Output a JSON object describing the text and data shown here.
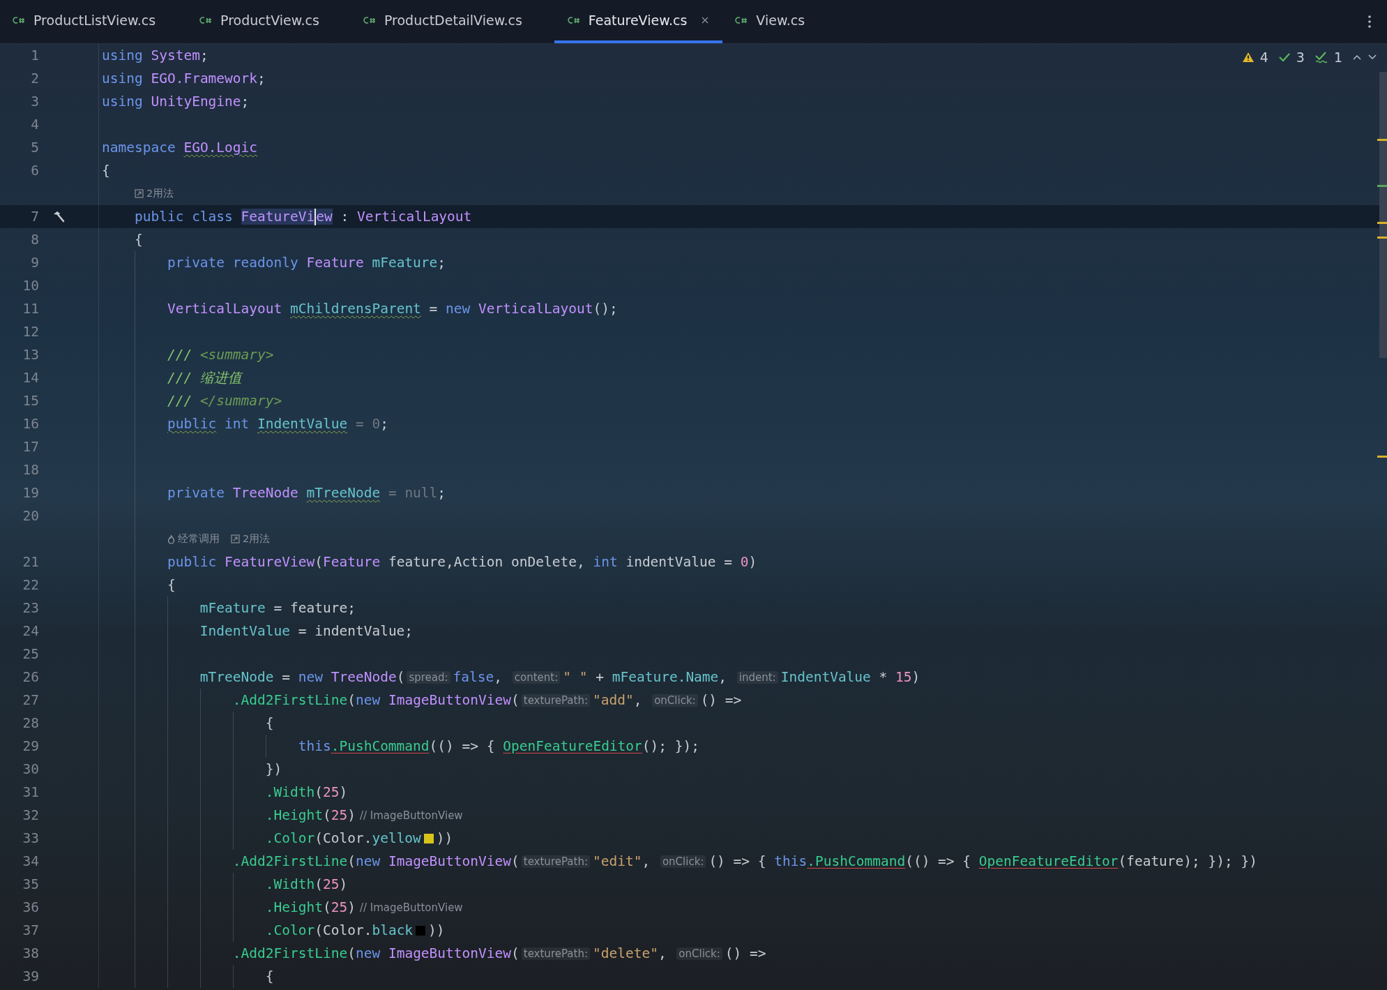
{
  "tabs": [
    {
      "label": "ProductListView.cs",
      "selected": false
    },
    {
      "label": "ProductView.cs",
      "selected": false
    },
    {
      "label": "ProductDetailView.cs",
      "selected": false
    },
    {
      "label": "FeatureView.cs",
      "selected": true
    },
    {
      "label": "View.cs",
      "selected": false
    }
  ],
  "inspections": {
    "warnings": "4",
    "weak_warnings": "3",
    "typos": "1"
  },
  "lines": [
    {
      "kind": "code",
      "number": "1",
      "tokens": [
        {
          "kind": "kw",
          "text": "using"
        },
        {
          "kind": "ns",
          "text": "System",
          "gap": true
        },
        {
          "kind": "plain",
          "text": ";"
        }
      ]
    },
    {
      "kind": "code",
      "number": "2",
      "tokens": [
        {
          "kind": "kw",
          "text": "using"
        },
        {
          "kind": "ns",
          "text": "EGO.Framework",
          "gap": true
        },
        {
          "kind": "plain",
          "text": ";"
        }
      ]
    },
    {
      "kind": "code",
      "number": "3",
      "tokens": [
        {
          "kind": "kw",
          "text": "using"
        },
        {
          "kind": "ns",
          "text": "UnityEngine",
          "gap": true
        },
        {
          "kind": "plain",
          "text": ";"
        }
      ]
    },
    {
      "kind": "code",
      "number": "4"
    },
    {
      "kind": "code",
      "number": "5",
      "tokens": [
        {
          "kind": "kw",
          "text": "namespace"
        },
        {
          "kind": "ns",
          "text": "EGO.Logic",
          "gap": true,
          "warning": true
        }
      ]
    },
    {
      "kind": "code",
      "number": "6",
      "tokens": [
        {
          "kind": "plain",
          "text": "{"
        }
      ],
      "children": [
        {
          "kind": "lens",
          "entries": [
            {
              "kind": "usages",
              "text": "2用法"
            }
          ]
        },
        {
          "kind": "code",
          "number": "7",
          "current": true,
          "build_marker": true,
          "tokens": [
            {
              "kind": "kw",
              "text": "public class"
            },
            {
              "kind": "type",
              "text": "FeatureVi",
              "gap": true,
              "highlight": true
            },
            {
              "kind": "caret"
            },
            {
              "kind": "type",
              "text": "ew",
              "highlight": true
            },
            {
              "kind": "plain",
              "text": " : "
            },
            {
              "kind": "type",
              "text": "VerticalLayout"
            }
          ]
        },
        {
          "kind": "code",
          "number": "8",
          "tokens": [
            {
              "kind": "plain",
              "text": "{"
            }
          ],
          "children": [
            {
              "kind": "code",
              "number": "9",
              "tokens": [
                {
                  "kind": "kw",
                  "text": "private readonly"
                },
                {
                  "kind": "type",
                  "text": "Feature",
                  "gap": true
                },
                {
                  "kind": "field",
                  "text": "mFeature",
                  "gap": true
                },
                {
                  "kind": "plain",
                  "text": ";"
                }
              ]
            },
            {
              "kind": "code",
              "number": "10"
            },
            {
              "kind": "code",
              "number": "11",
              "tokens": [
                {
                  "kind": "type",
                  "text": "VerticalLayout"
                },
                {
                  "kind": "field",
                  "text": "mChildrensParent",
                  "gap": true,
                  "warning": true
                },
                {
                  "kind": "plain",
                  "text": " = "
                },
                {
                  "kind": "kw",
                  "text": "new"
                },
                {
                  "kind": "type",
                  "text": "VerticalLayout",
                  "gap": true
                },
                {
                  "kind": "plain",
                  "text": "();"
                }
              ]
            },
            {
              "kind": "code",
              "number": "12"
            },
            {
              "kind": "code",
              "number": "13",
              "tokens": [
                {
                  "kind": "comment",
                  "text": "///"
                },
                {
                  "kind": "doctag",
                  "text": "<summary>",
                  "gap": true
                }
              ]
            },
            {
              "kind": "code",
              "number": "14",
              "tokens": [
                {
                  "kind": "comment",
                  "text": "/// 缩进值"
                }
              ]
            },
            {
              "kind": "code",
              "number": "15",
              "tokens": [
                {
                  "kind": "comment",
                  "text": "///"
                },
                {
                  "kind": "doctag",
                  "text": "</summary>",
                  "gap": true
                }
              ]
            },
            {
              "kind": "code",
              "number": "16",
              "tokens": [
                {
                  "kind": "kw",
                  "text": "public",
                  "warning": true
                },
                {
                  "kind": "kw",
                  "text": "int",
                  "gap": true
                },
                {
                  "kind": "field",
                  "text": "IndentValue",
                  "gap": true,
                  "warning": true
                },
                {
                  "kind": "dim",
                  "text": " = 0"
                },
                {
                  "kind": "plain",
                  "text": ";"
                }
              ]
            },
            {
              "kind": "code",
              "number": "17"
            },
            {
              "kind": "code",
              "number": "18"
            },
            {
              "kind": "code",
              "number": "19",
              "tokens": [
                {
                  "kind": "kw",
                  "text": "private"
                },
                {
                  "kind": "type",
                  "text": "TreeNode",
                  "gap": true
                },
                {
                  "kind": "field",
                  "text": "mTreeNode",
                  "gap": true,
                  "warning": true
                },
                {
                  "kind": "dim",
                  "text": " = null"
                },
                {
                  "kind": "plain",
                  "text": ";"
                }
              ]
            },
            {
              "kind": "code",
              "number": "20"
            },
            {
              "kind": "lens",
              "entries": [
                {
                  "kind": "frequent",
                  "text": "经常调用"
                },
                {
                  "kind": "usages",
                  "text": "2用法"
                }
              ]
            },
            {
              "kind": "code",
              "number": "21",
              "tokens": [
                {
                  "kind": "kw",
                  "text": "public"
                },
                {
                  "kind": "type",
                  "text": "FeatureView",
                  "gap": true
                },
                {
                  "kind": "plain",
                  "text": "("
                },
                {
                  "kind": "type",
                  "text": "Feature"
                },
                {
                  "kind": "plain",
                  "text": " feature,Action onDelete, "
                },
                {
                  "kind": "kw",
                  "text": "int"
                },
                {
                  "kind": "plain",
                  "text": " indentValue = "
                },
                {
                  "kind": "num",
                  "text": "0"
                },
                {
                  "kind": "plain",
                  "text": ")"
                }
              ]
            },
            {
              "kind": "code",
              "number": "22",
              "tokens": [
                {
                  "kind": "plain",
                  "text": "{"
                }
              ],
              "children": [
                {
                  "kind": "code",
                  "number": "23",
                  "tokens": [
                    {
                      "kind": "field",
                      "text": "mFeature"
                    },
                    {
                      "kind": "plain",
                      "text": " = feature;"
                    }
                  ]
                },
                {
                  "kind": "code",
                  "number": "24",
                  "tokens": [
                    {
                      "kind": "field",
                      "text": "IndentValue"
                    },
                    {
                      "kind": "plain",
                      "text": " = indentValue;"
                    }
                  ]
                },
                {
                  "kind": "code",
                  "number": "25"
                },
                {
                  "kind": "code",
                  "number": "26",
                  "tokens": [
                    {
                      "kind": "field",
                      "text": "mTreeNode"
                    },
                    {
                      "kind": "plain",
                      "text": " = "
                    },
                    {
                      "kind": "kw",
                      "text": "new"
                    },
                    {
                      "kind": "type",
                      "text": "TreeNode",
                      "gap": true
                    },
                    {
                      "kind": "plain",
                      "text": "("
                    },
                    {
                      "kind": "hint",
                      "text": "spread:"
                    },
                    {
                      "kind": "kw",
                      "text": "false"
                    },
                    {
                      "kind": "plain",
                      "text": ", "
                    },
                    {
                      "kind": "hint",
                      "text": "content:"
                    },
                    {
                      "kind": "str",
                      "text": "\" \""
                    },
                    {
                      "kind": "plain",
                      "text": " + "
                    },
                    {
                      "kind": "field",
                      "text": "mFeature"
                    },
                    {
                      "kind": "field",
                      "text": ".Name"
                    },
                    {
                      "kind": "plain",
                      "text": ", "
                    },
                    {
                      "kind": "hint",
                      "text": "indent:"
                    },
                    {
                      "kind": "field",
                      "text": "IndentValue"
                    },
                    {
                      "kind": "plain",
                      "text": " * "
                    },
                    {
                      "kind": "num",
                      "text": "15"
                    },
                    {
                      "kind": "plain",
                      "text": ")"
                    }
                  ],
                  "children": [
                    {
                      "kind": "code",
                      "number": "27",
                      "tokens": [
                        {
                          "kind": "method",
                          "text": ".Add2FirstLine"
                        },
                        {
                          "kind": "plain",
                          "text": "("
                        },
                        {
                          "kind": "kw",
                          "text": "new"
                        },
                        {
                          "kind": "type",
                          "text": "ImageButtonView",
                          "gap": true
                        },
                        {
                          "kind": "plain",
                          "text": "("
                        },
                        {
                          "kind": "hint",
                          "text": "texturePath:"
                        },
                        {
                          "kind": "str",
                          "text": "\"add\""
                        },
                        {
                          "kind": "plain",
                          "text": ", "
                        },
                        {
                          "kind": "hint",
                          "text": "onClick:"
                        },
                        {
                          "kind": "plain",
                          "text": "() =>"
                        }
                      ],
                      "children": [
                        {
                          "kind": "code",
                          "number": "28",
                          "tokens": [
                            {
                              "kind": "plain",
                              "text": "{"
                            }
                          ],
                          "children": [
                            {
                              "kind": "code",
                              "number": "29",
                              "tokens": [
                                {
                                  "kind": "kw",
                                  "text": "this"
                                },
                                {
                                  "kind": "method",
                                  "text": ".PushCommand",
                                  "error": true
                                },
                                {
                                  "kind": "plain",
                                  "text": "(() => { "
                                },
                                {
                                  "kind": "method",
                                  "text": "OpenFeatureEditor",
                                  "error": true
                                },
                                {
                                  "kind": "plain",
                                  "text": "(); });"
                                }
                              ]
                            }
                          ]
                        },
                        {
                          "kind": "code",
                          "number": "30",
                          "tokens": [
                            {
                              "kind": "plain",
                              "text": "})"
                            }
                          ]
                        },
                        {
                          "kind": "code",
                          "number": "31",
                          "tokens": [
                            {
                              "kind": "method",
                              "text": ".Width"
                            },
                            {
                              "kind": "plain",
                              "text": "("
                            },
                            {
                              "kind": "num",
                              "text": "25"
                            },
                            {
                              "kind": "plain",
                              "text": ")"
                            }
                          ]
                        },
                        {
                          "kind": "code",
                          "number": "32",
                          "tokens": [
                            {
                              "kind": "method",
                              "text": ".Height"
                            },
                            {
                              "kind": "plain",
                              "text": "("
                            },
                            {
                              "kind": "num",
                              "text": "25"
                            },
                            {
                              "kind": "plain",
                              "text": ")"
                            },
                            {
                              "kind": "note",
                              "text": "// ImageButtonView"
                            }
                          ]
                        },
                        {
                          "kind": "code",
                          "number": "33",
                          "tokens": [
                            {
                              "kind": "method",
                              "text": ".Color"
                            },
                            {
                              "kind": "plain",
                              "text": "(Color."
                            },
                            {
                              "kind": "field",
                              "text": "yellow"
                            },
                            {
                              "kind": "swatch",
                              "color": "#d8c31b"
                            },
                            {
                              "kind": "plain",
                              "text": "))"
                            }
                          ]
                        }
                      ]
                    },
                    {
                      "kind": "code",
                      "number": "34",
                      "tokens": [
                        {
                          "kind": "method",
                          "text": ".Add2FirstLine"
                        },
                        {
                          "kind": "plain",
                          "text": "("
                        },
                        {
                          "kind": "kw",
                          "text": "new"
                        },
                        {
                          "kind": "type",
                          "text": "ImageButtonView",
                          "gap": true
                        },
                        {
                          "kind": "plain",
                          "text": "("
                        },
                        {
                          "kind": "hint",
                          "text": "texturePath:"
                        },
                        {
                          "kind": "str",
                          "text": "\"edit\""
                        },
                        {
                          "kind": "plain",
                          "text": ", "
                        },
                        {
                          "kind": "hint",
                          "text": "onClick:"
                        },
                        {
                          "kind": "plain",
                          "text": "() => { "
                        },
                        {
                          "kind": "kw",
                          "text": "this"
                        },
                        {
                          "kind": "method",
                          "text": ".PushCommand",
                          "error": true
                        },
                        {
                          "kind": "plain",
                          "text": "(() => { "
                        },
                        {
                          "kind": "method",
                          "text": "OpenFeatureEditor",
                          "error": true
                        },
                        {
                          "kind": "plain",
                          "text": "(feature); }); })"
                        }
                      ],
                      "children": [
                        {
                          "kind": "code",
                          "number": "35",
                          "tokens": [
                            {
                              "kind": "method",
                              "text": ".Width"
                            },
                            {
                              "kind": "plain",
                              "text": "("
                            },
                            {
                              "kind": "num",
                              "text": "25"
                            },
                            {
                              "kind": "plain",
                              "text": ")"
                            }
                          ]
                        },
                        {
                          "kind": "code",
                          "number": "36",
                          "tokens": [
                            {
                              "kind": "method",
                              "text": ".Height"
                            },
                            {
                              "kind": "plain",
                              "text": "("
                            },
                            {
                              "kind": "num",
                              "text": "25"
                            },
                            {
                              "kind": "plain",
                              "text": ")"
                            },
                            {
                              "kind": "note",
                              "text": "// ImageButtonView"
                            }
                          ]
                        },
                        {
                          "kind": "code",
                          "number": "37",
                          "tokens": [
                            {
                              "kind": "method",
                              "text": ".Color"
                            },
                            {
                              "kind": "plain",
                              "text": "(Color."
                            },
                            {
                              "kind": "field",
                              "text": "black"
                            },
                            {
                              "kind": "swatch",
                              "color": "#000000"
                            },
                            {
                              "kind": "plain",
                              "text": "))"
                            }
                          ]
                        }
                      ]
                    },
                    {
                      "kind": "code",
                      "number": "38",
                      "tokens": [
                        {
                          "kind": "method",
                          "text": ".Add2FirstLine"
                        },
                        {
                          "kind": "plain",
                          "text": "("
                        },
                        {
                          "kind": "kw",
                          "text": "new"
                        },
                        {
                          "kind": "type",
                          "text": "ImageButtonView",
                          "gap": true
                        },
                        {
                          "kind": "plain",
                          "text": "("
                        },
                        {
                          "kind": "hint",
                          "text": "texturePath:"
                        },
                        {
                          "kind": "str",
                          "text": "\"delete\""
                        },
                        {
                          "kind": "plain",
                          "text": ", "
                        },
                        {
                          "kind": "hint",
                          "text": "onClick:"
                        },
                        {
                          "kind": "plain",
                          "text": "() =>"
                        }
                      ],
                      "children": [
                        {
                          "kind": "code",
                          "number": "39",
                          "tokens": [
                            {
                              "kind": "plain",
                              "text": "{"
                            }
                          ]
                        }
                      ]
                    }
                  ]
                }
              ]
            }
          ]
        }
      ]
    }
  ]
}
